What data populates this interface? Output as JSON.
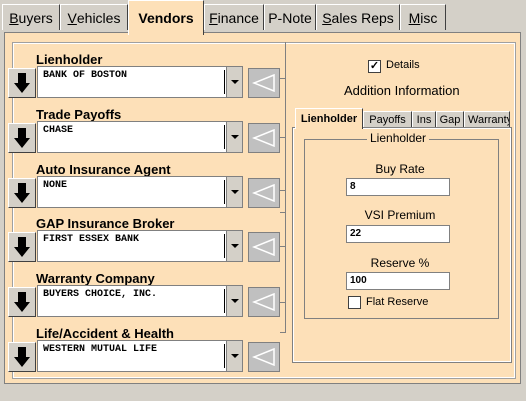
{
  "tabs": [
    {
      "label": "Buyers",
      "underline": "B",
      "rest": "uyers"
    },
    {
      "label": "Vehicles",
      "underline": "V",
      "rest": "ehicles"
    },
    {
      "label": "Vendors",
      "underline": "",
      "rest": "Vendors"
    },
    {
      "label": "Finance",
      "underline": "F",
      "rest": "inance"
    },
    {
      "label": "P-Note",
      "underline": "",
      "rest": "P-Note"
    },
    {
      "label": "Sales Reps",
      "underline": "S",
      "rest": "ales Reps"
    },
    {
      "label": "Misc",
      "underline": "M",
      "rest": "isc"
    }
  ],
  "vendors": [
    {
      "label": "Lienholder",
      "value": "BANK OF BOSTON"
    },
    {
      "label": "Trade Payoffs",
      "value": "CHASE"
    },
    {
      "label": "Auto Insurance Agent",
      "value": "NONE"
    },
    {
      "label": "GAP Insurance Broker",
      "value": "FIRST ESSEX BANK"
    },
    {
      "label": "Warranty Company",
      "value": "BUYERS CHOICE, INC."
    },
    {
      "label": "Life/Accident & Health",
      "value": "WESTERN MUTUAL LIFE"
    }
  ],
  "details": {
    "label": "Details",
    "checked": true,
    "mark": "✓"
  },
  "addition_info": "Addition Information",
  "subtabs": [
    "Lienholder",
    "Payoffs",
    "Ins",
    "Gap",
    "Warranty"
  ],
  "group_title": "Lienholder",
  "fields": [
    {
      "label": "Buy Rate",
      "value": "8"
    },
    {
      "label": "VSI Premium",
      "value": "22"
    },
    {
      "label": "Reserve %",
      "value": "100"
    }
  ],
  "flat_reserve": {
    "label": "Flat Reserve",
    "checked": false
  },
  "colors": {
    "panel": "#fde0b8",
    "chrome": "#d4d0c8"
  },
  "icons": {
    "arrow": "down-arrow-icon",
    "side": "triangle-icon"
  }
}
